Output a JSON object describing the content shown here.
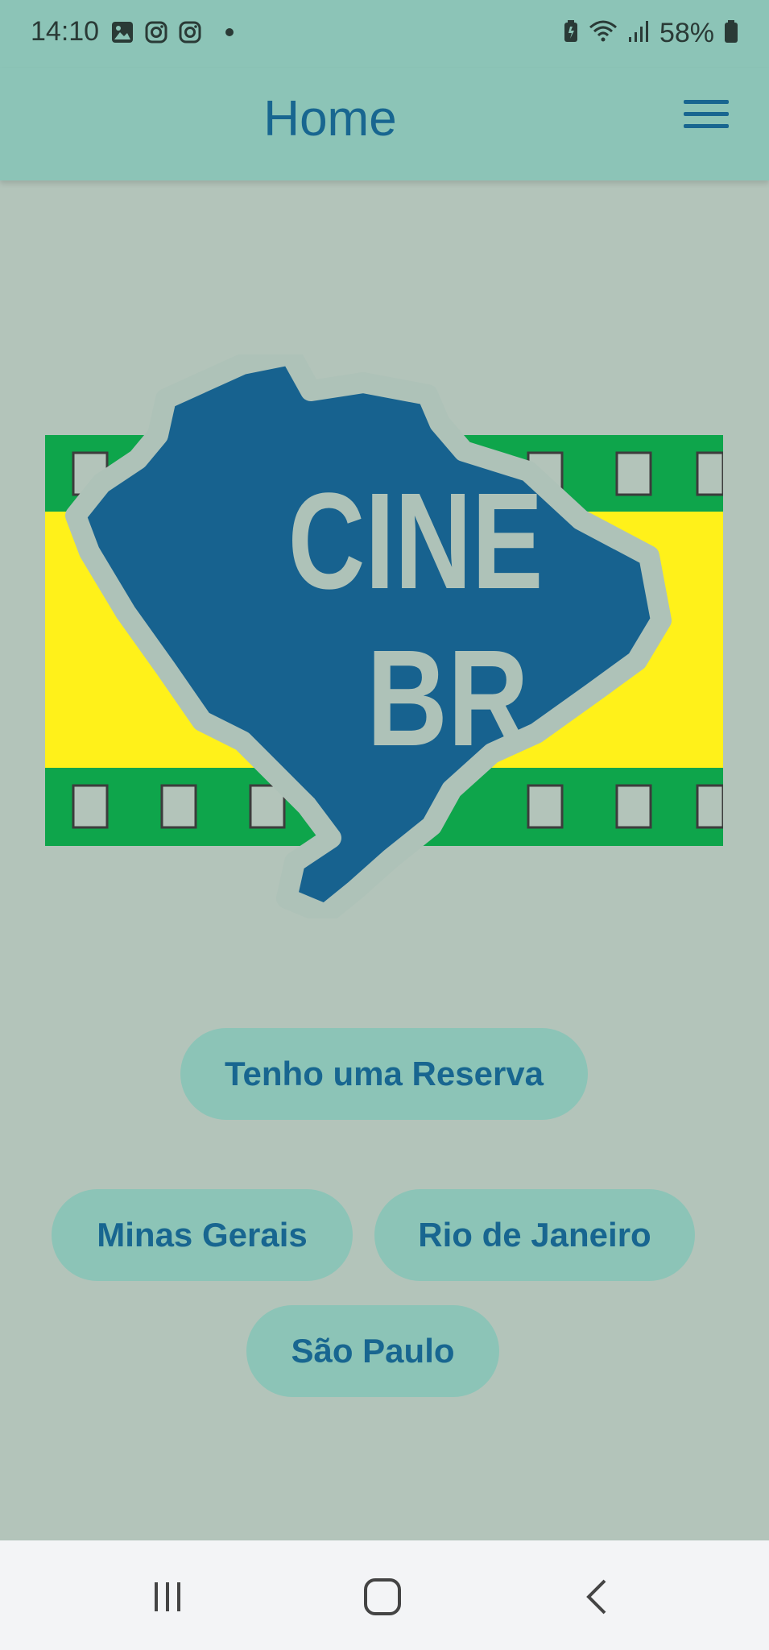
{
  "status_bar": {
    "time": "14:10",
    "battery": "58%",
    "icons_left": [
      "gallery-icon",
      "instagram-icon",
      "instagram-icon"
    ],
    "icons_right": [
      "battery-saver-icon",
      "wifi-icon",
      "signal-icon",
      "battery-icon"
    ]
  },
  "app_bar": {
    "title": "Home",
    "menu_icon": "hamburger-menu-icon"
  },
  "logo": {
    "line1": "CINE",
    "line2": "BR",
    "colors": {
      "film_green": "#0ea54b",
      "band_yellow": "#fff11a",
      "map_blue": "#17628f",
      "outline": "#aec2b8"
    }
  },
  "buttons": {
    "reservation": "Tenho uma Reserva",
    "minas": "Minas Gerais",
    "rio": "Rio de Janeiro",
    "sao_paulo": "São Paulo"
  },
  "system_nav": {
    "recents_icon": "recents-icon",
    "home_icon": "home-icon",
    "back_icon": "back-icon"
  },
  "colors": {
    "background": "#b3c4ba",
    "app_bar": "#8cc4b7",
    "accent": "#186690",
    "nav_bar": "#f3f4f6"
  }
}
